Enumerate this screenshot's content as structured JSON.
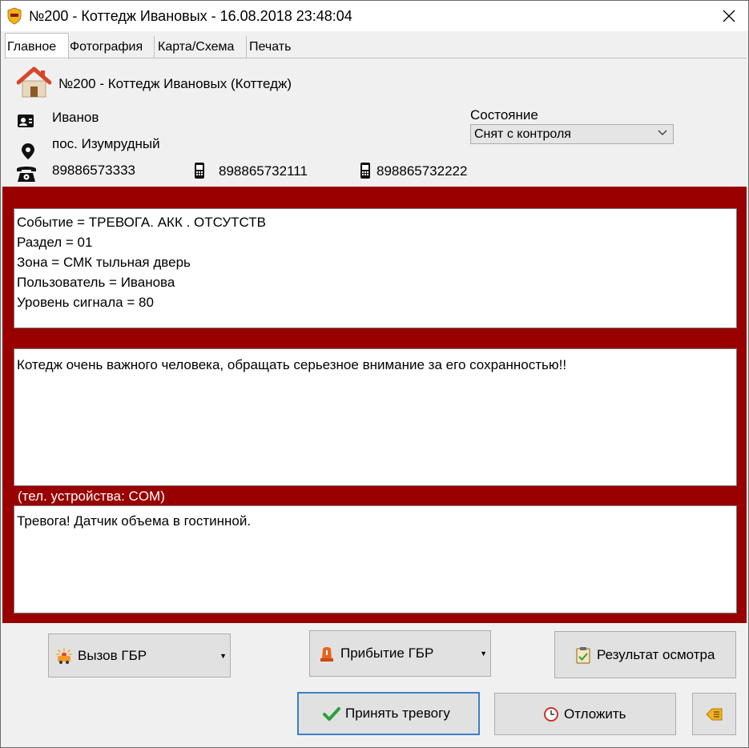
{
  "window": {
    "title": "№200 - Коттедж Ивановых - 16.08.2018 23:48:04"
  },
  "tabs": [
    {
      "label": "Главное"
    },
    {
      "label": "Фотография"
    },
    {
      "label": "Карта/Схема"
    },
    {
      "label": "Печать"
    }
  ],
  "object": {
    "title": "№200 - Коттедж Ивановых (Коттедж)",
    "owner": "Иванов",
    "address": "пос. Изумрудный",
    "phone": "89886573333",
    "mobile1": "898865732111",
    "mobile2": "898865732222"
  },
  "state": {
    "label": "Состояние",
    "value": "Снят с контроля"
  },
  "event": {
    "lines": [
      "Событие = ТРЕВОГА. АКК . ОТСУТСТВ",
      "Раздел = 01",
      "Зона = СМК тыльная дверь",
      "Пользователь = Иванова",
      "Уровень сигнала = 80"
    ]
  },
  "note": {
    "text": "Котедж очень важного человека, обращать серьезное внимание за его сохранностью!!"
  },
  "device_label": "(тел. устройства: COM)",
  "description": {
    "text": "Тревога! Датчик объема в гостинной."
  },
  "buttons": {
    "call_gbr": "Вызов ГБР",
    "arrival_gbr": "Прибытие ГБР",
    "inspection": "Результат осмотра",
    "accept": "Принять тревогу",
    "postpone": "Отложить"
  },
  "colors": {
    "alarm_red": "#990000",
    "accept_green": "#2e9e3e",
    "button_blue_border": "#3c7fc8"
  },
  "icons": {
    "app": "shield-icon",
    "close": "close-icon",
    "object": "house-icon",
    "owner": "id-card-icon",
    "address": "location-pin-icon",
    "phone": "telephone-icon",
    "mobile": "mobile-phone-icon",
    "call": "siren-car-icon",
    "arrival": "siren-icon",
    "inspection": "clipboard-check-icon",
    "accept": "checkmark-icon",
    "postpone": "clock-icon",
    "extra": "note-arrow-icon"
  }
}
